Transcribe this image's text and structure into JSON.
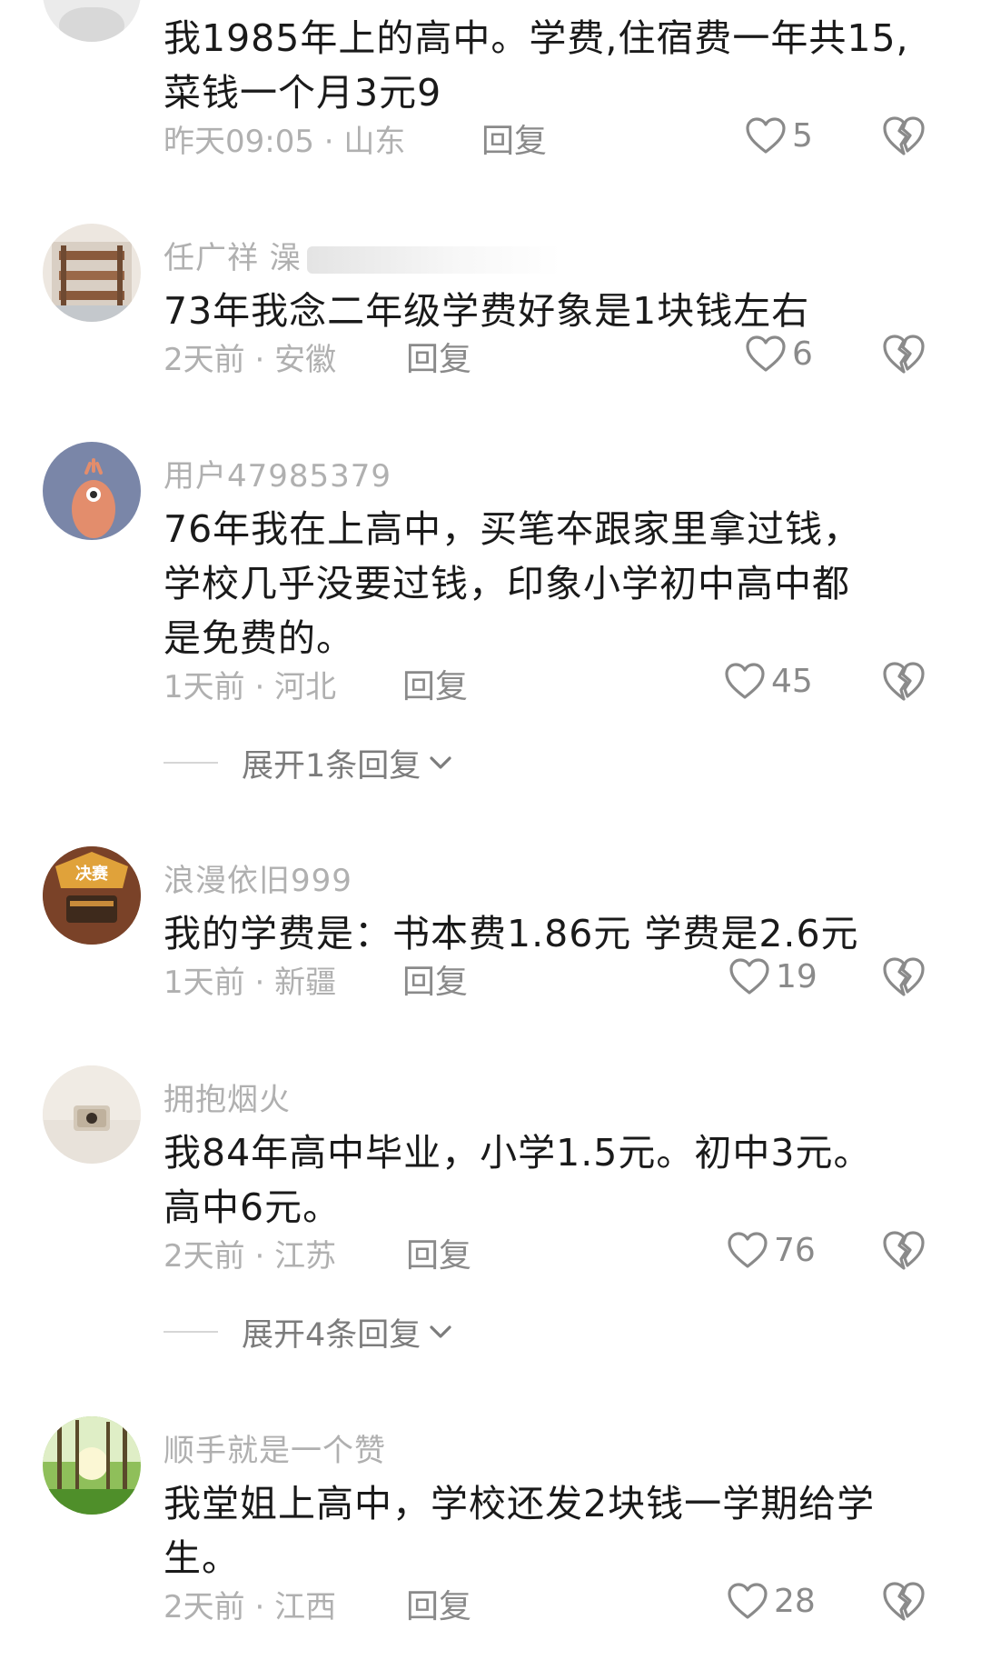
{
  "comments": [
    {
      "username": "",
      "content": "我1985年上的高中。学费,住宿费一年共15,\n菜钱一个月3元9",
      "time": "昨天09:05",
      "location": "山东",
      "reply_label": "回复",
      "likes": "5"
    },
    {
      "username": "任广祥 澡",
      "content": "73年我念二年级学费好象是1块钱左右",
      "time": "2天前",
      "location": "安徽",
      "reply_label": "回复",
      "likes": "6"
    },
    {
      "username": "用户47985379",
      "content": "76年我在上高中，买笔夲跟家里拿过钱，\n学校几乎没要过钱，印象小学初中高中都\n是免费的。",
      "time": "1天前",
      "location": "河北",
      "reply_label": "回复",
      "likes": "45",
      "expand_label": "展开1条回复"
    },
    {
      "username": "浪漫依旧999",
      "content": "我的学费是：书本费1.86元  学费是2.6元",
      "time": "1天前",
      "location": "新疆",
      "reply_label": "回复",
      "likes": "19"
    },
    {
      "username": "拥抱烟火",
      "content": "我84年高中毕业，小学1.5元。初中3元。\n高中6元。",
      "time": "2天前",
      "location": "江苏",
      "reply_label": "回复",
      "likes": "76",
      "expand_label": "展开4条回复"
    },
    {
      "username": "顺手就是一个赞",
      "content": "我堂姐上高中，学校还发2块钱一学期给学\n生。",
      "time": "2天前",
      "location": "江西",
      "reply_label": "回复",
      "likes": "28"
    }
  ],
  "meta_separator": " · ",
  "avatar_badge_text": "决赛",
  "icons": {
    "like": "heart-outline-icon",
    "dislike": "broken-heart-icon",
    "expand": "chevron-down-icon"
  },
  "colors": {
    "text": "#1a1a1a",
    "muted": "#b0b0b0",
    "icon": "#8a8a8a"
  }
}
